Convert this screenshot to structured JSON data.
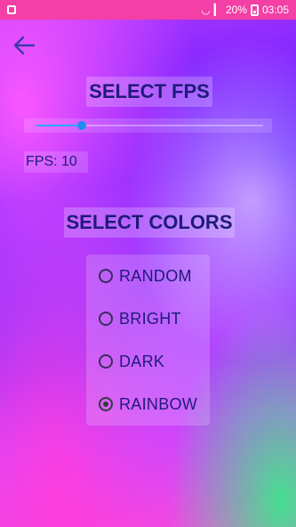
{
  "statusbar": {
    "battery": "20%",
    "time": "03:05"
  },
  "header": {
    "back_icon": "arrow-left-icon"
  },
  "fps": {
    "title": "SELECT FPS",
    "label": "FPS: 10",
    "slider_fraction": 0.2
  },
  "colors": {
    "title": "SELECT COLORS",
    "options": [
      {
        "label": "RANDOM",
        "checked": false
      },
      {
        "label": "BRIGHT",
        "checked": false
      },
      {
        "label": "DARK",
        "checked": false
      },
      {
        "label": "RAINBOW",
        "checked": true
      }
    ]
  },
  "palette": {
    "statusbar": "#f33fa6",
    "heading_text": "#1f1a7a",
    "slider_accent": "#1f8df0"
  }
}
